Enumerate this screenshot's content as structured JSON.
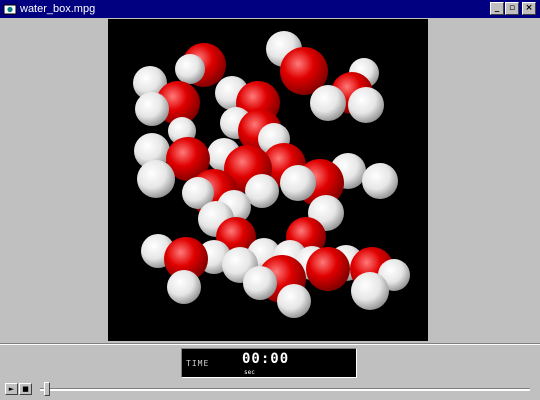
{
  "window": {
    "title": "water_box.mpg",
    "buttons": {
      "minimize": "_",
      "maximize": "▫",
      "close": "×"
    },
    "active_title_color": "#000080"
  },
  "video": {
    "background": "#000000",
    "molecule_colors": {
      "oxygen": "#dc0000",
      "hydrogen": "#f0f0f0"
    }
  },
  "display": {
    "mode_label": "TIME",
    "time": "00:00",
    "unit": "sec"
  },
  "controls": {
    "play_icon": "►",
    "stop_icon": "■",
    "position_fraction": 0.0
  }
}
